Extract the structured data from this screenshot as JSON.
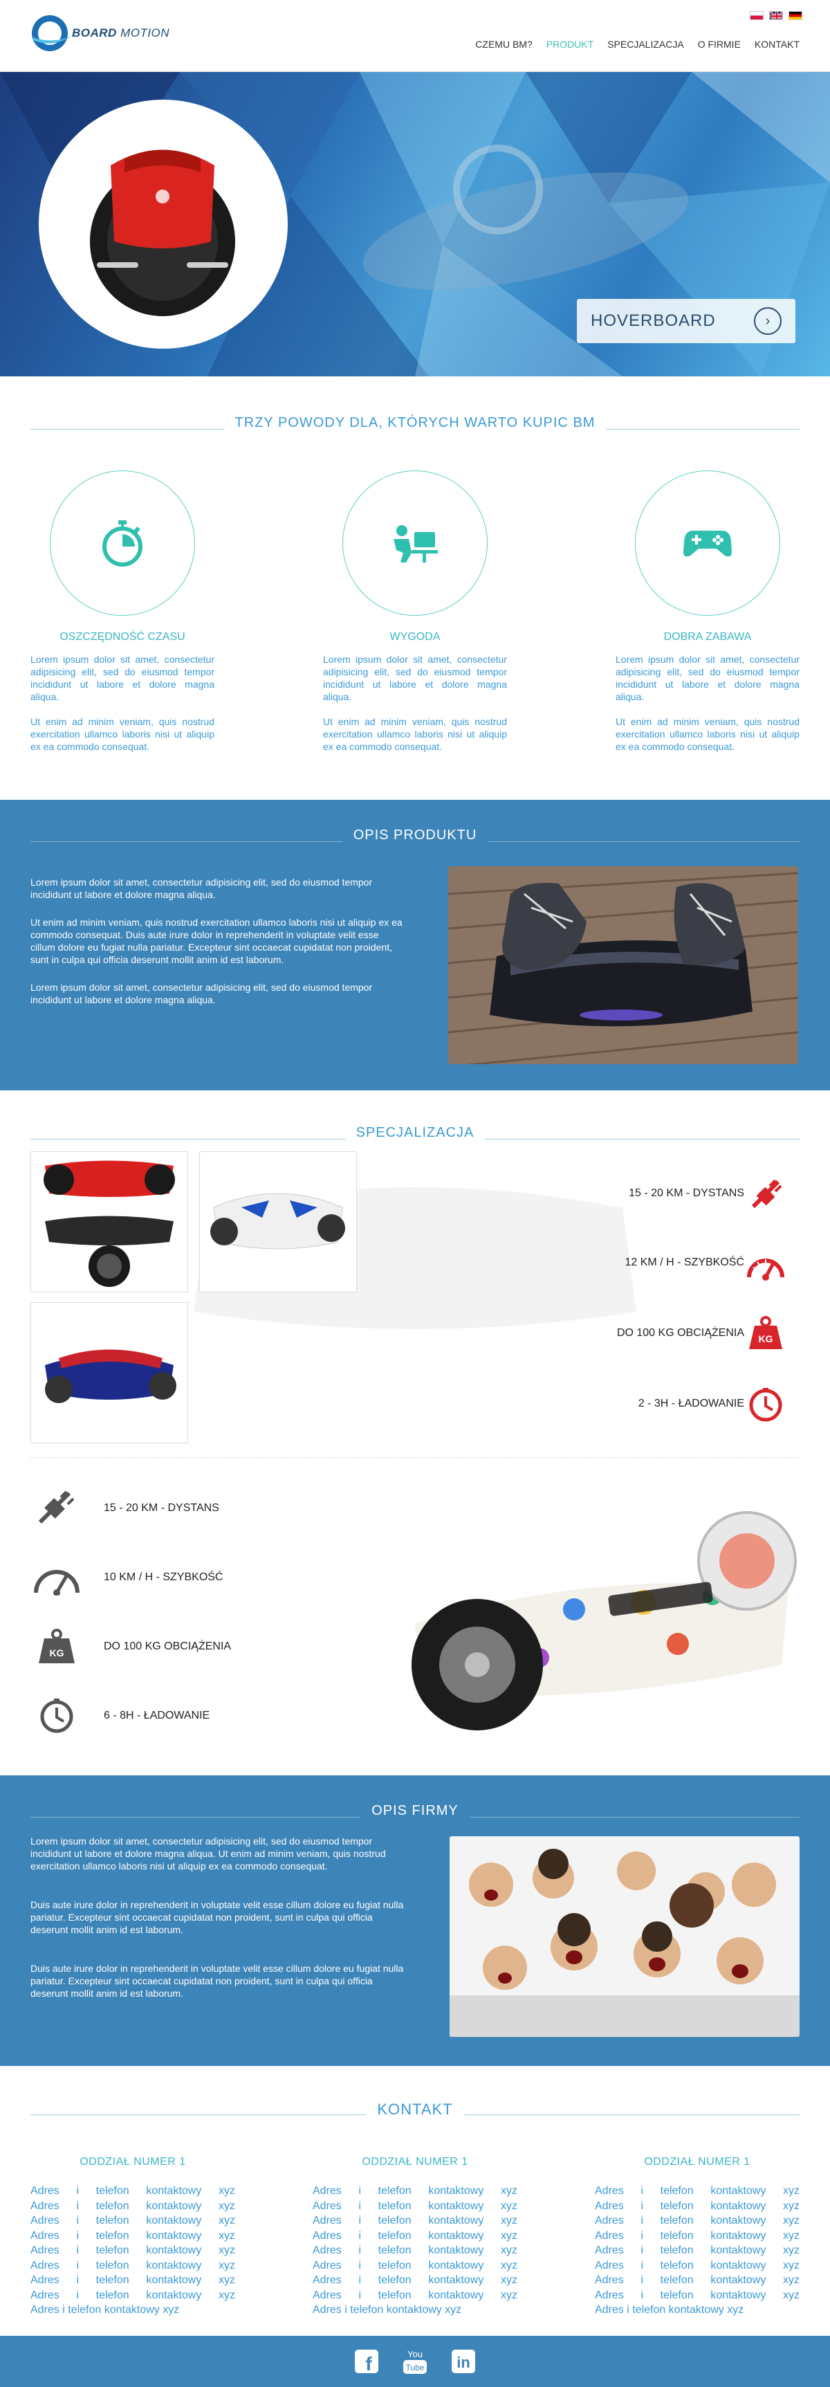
{
  "header": {
    "logo_bold": "BOARD",
    "logo_light": " MOTION",
    "flags": [
      "pl-flag",
      "uk-flag",
      "de-flag"
    ],
    "nav": [
      {
        "label": "CZEMU BM?",
        "active": false
      },
      {
        "label": "PRODUKT",
        "active": true
      },
      {
        "label": "SPECJALIZACJA",
        "active": false
      },
      {
        "label": "O FIRMIE",
        "active": false
      },
      {
        "label": "KONTAKT",
        "active": false
      }
    ]
  },
  "hero": {
    "button_label": "HOVERBOARD",
    "button_icon": "chevron-right-icon"
  },
  "reasons": {
    "title": "TRZY POWODY DLA, KTÓRYCH WARTO KUPIC BM",
    "items": [
      {
        "icon": "stopwatch-icon",
        "heading": "OSZCZĘDNOŚĆ CZASU",
        "p1": "Lorem ipsum dolor sit amet, consectetur adipisicing elit, sed do eiusmod tempor incididunt ut labore et dolore magna aliqua.",
        "p2": "Ut enim ad minim veniam, quis nostrud exercitation ullamco laboris nisi ut aliquip ex ea commodo consequat."
      },
      {
        "icon": "desk-worker-icon",
        "heading": "WYGODA",
        "p1": "Lorem ipsum dolor sit amet, consectetur adipisicing elit, sed do eiusmod tempor incididunt ut labore et dolore magna aliqua.",
        "p2": "Ut enim ad minim veniam, quis nostrud exercitation ullamco laboris nisi ut aliquip ex ea commodo consequat."
      },
      {
        "icon": "gamepad-icon",
        "heading": "DOBRA ZABAWA",
        "p1": "Lorem ipsum dolor sit amet, consectetur adipisicing elit, sed do eiusmod tempor incididunt ut labore et dolore magna aliqua.",
        "p2": "Ut enim ad minim veniam, quis nostrud exercitation ullamco laboris nisi ut aliquip ex ea commodo consequat."
      }
    ]
  },
  "opis_produktu": {
    "title": "OPIS PRODUKTU",
    "p1": "Lorem ipsum dolor sit amet, consectetur adipisicing elit, sed do eiusmod tempor incididunt ut labore et dolore magna aliqua.",
    "p2": "Ut enim ad minim veniam, quis nostrud exercitation ullamco laboris nisi ut aliquip ex ea commodo consequat. Duis aute irure dolor in reprehenderit in voluptate velit esse cillum dolore eu fugiat nulla pariatur. Excepteur sint occaecat cupidatat non proident, sunt in culpa qui officia deserunt mollit anim id est laborum.",
    "p3": "Lorem ipsum dolor sit amet, consectetur adipisicing elit, sed do eiusmod tempor incididunt ut labore et dolore magna aliqua."
  },
  "specjalizacja": {
    "title": "SPECJALIZACJA",
    "specs": [
      {
        "label": "15 - 20 KM - DYSTANS",
        "icon": "plug-icon"
      },
      {
        "label": "12 KM / H - SZYBKOŚĆ",
        "icon": "speedometer-icon"
      },
      {
        "label": "DO 100 KG OBCIĄŻENIA",
        "icon": "weight-icon"
      },
      {
        "label": "2 - 3H - ŁADOWANIE",
        "icon": "clock-icon"
      }
    ],
    "weight_text": "KG"
  },
  "features": [
    {
      "label": "15 - 20 KM - DYSTANS",
      "icon": "plug-icon"
    },
    {
      "label": "10 KM / H - SZYBKOŚĆ",
      "icon": "speedometer-icon"
    },
    {
      "label": "DO 100 KG OBCIĄŻENIA",
      "icon": "weight-icon"
    },
    {
      "label": "6 - 8H - ŁADOWANIE",
      "icon": "clock-icon"
    }
  ],
  "opis_firmy": {
    "title": "OPIS FIRMY",
    "p1": "Lorem ipsum dolor sit amet, consectetur adipisicing elit, sed do eiusmod tempor incididunt ut labore et dolore magna aliqua. Ut enim ad minim veniam, quis nostrud exercitation ullamco laboris nisi ut aliquip ex ea commodo consequat.",
    "p2": "Duis aute irure dolor in reprehenderit in voluptate velit esse cillum dolore eu fugiat nulla pariatur. Excepteur sint occaecat cupidatat non proident, sunt in culpa qui officia deserunt mollit anim id est laborum.",
    "p3": "Duis aute irure dolor in reprehenderit in voluptate velit esse cillum dolore eu fugiat nulla pariatur. Excepteur sint occaecat cupidatat non proident, sunt in culpa qui officia deserunt mollit anim id est laborum."
  },
  "kontakt": {
    "title": "KONTAKT",
    "branches": [
      {
        "heading": "ODDZIAŁ NUMER 1",
        "lines": [
          "Adres i telefon kontaktowy xyz",
          "Adres i telefon kontaktowy xyz",
          "Adres i telefon kontaktowy xyz",
          "Adres i telefon kontaktowy xyz",
          "Adres i telefon kontaktowy xyz",
          "Adres i telefon kontaktowy xyz",
          "Adres i telefon kontaktowy xyz",
          "Adres i telefon kontaktowy xyz",
          "Adres i telefon kontaktowy xyz"
        ]
      },
      {
        "heading": "ODDZIAŁ NUMER 1",
        "lines": [
          "Adres i telefon kontaktowy xyz",
          "Adres i telefon kontaktowy xyz",
          "Adres i telefon kontaktowy xyz",
          "Adres i telefon kontaktowy xyz",
          "Adres i telefon kontaktowy xyz",
          "Adres i telefon kontaktowy xyz",
          "Adres i telefon kontaktowy xyz",
          "Adres i telefon kontaktowy xyz",
          "Adres i telefon kontaktowy xyz"
        ]
      },
      {
        "heading": "ODDZIAŁ NUMER 1",
        "lines": [
          "Adres i telefon kontaktowy xyz",
          "Adres i telefon kontaktowy xyz",
          "Adres i telefon kontaktowy xyz",
          "Adres i telefon kontaktowy xyz",
          "Adres i telefon kontaktowy xyz",
          "Adres i telefon kontaktowy xyz",
          "Adres i telefon kontaktowy xyz",
          "Adres i telefon kontaktowy xyz",
          "Adres i telefon kontaktowy xyz"
        ]
      }
    ]
  },
  "footer": {
    "social": [
      {
        "icon": "facebook-icon",
        "text": "f"
      },
      {
        "icon": "youtube-icon",
        "top": "You",
        "bottom": "Tube"
      },
      {
        "icon": "linkedin-icon",
        "text": "in"
      }
    ]
  },
  "colors": {
    "accent_teal": "#3fc1b0",
    "brand_blue": "#3d84b8",
    "text_blue": "#3c9ad5",
    "icon_red": "#d9242b"
  }
}
